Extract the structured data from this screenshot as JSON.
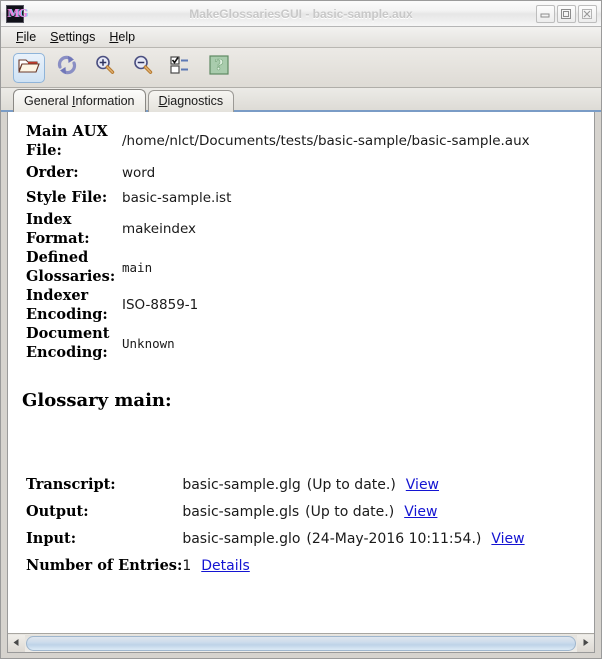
{
  "window": {
    "title": "MakeGlossariesGUI - basic-sample.aux",
    "app_icon": "MG",
    "controls": {
      "minimize": "minimize-icon",
      "maximize": "maximize-icon",
      "close": "close-icon"
    }
  },
  "menubar": {
    "items": [
      {
        "label": "File",
        "mnemonic": "F"
      },
      {
        "label": "Settings",
        "mnemonic": "S"
      },
      {
        "label": "Help",
        "mnemonic": "H"
      }
    ]
  },
  "toolbar": {
    "buttons": [
      {
        "icon": "open-folder-icon",
        "name": "open-button",
        "active": true
      },
      {
        "icon": "refresh-icon",
        "name": "reload-button",
        "active": false
      },
      {
        "icon": "zoom-in-icon",
        "name": "zoom-in-button",
        "active": false
      },
      {
        "icon": "zoom-out-icon",
        "name": "zoom-out-button",
        "active": false
      },
      {
        "icon": "checklist-icon",
        "name": "settings-button",
        "active": false
      },
      {
        "icon": "help-icon",
        "name": "help-button",
        "active": false
      }
    ]
  },
  "tabs": [
    {
      "label": "General Information",
      "mnemonic": "I",
      "selected": true
    },
    {
      "label": "Diagnostics",
      "mnemonic": "D",
      "selected": false
    }
  ],
  "general_info": {
    "rows": [
      {
        "label": "Main AUX File:",
        "value": "/home/nlct/Documents/tests/basic-sample/basic-sample.aux",
        "mono": false,
        "tall": true
      },
      {
        "label": "Order:",
        "value": "word",
        "mono": false,
        "tall": false
      },
      {
        "label": "Style File:",
        "value": "basic-sample.ist",
        "mono": false,
        "tall": false
      },
      {
        "label": "Index Format:",
        "value": "makeindex",
        "mono": false,
        "tall": true
      },
      {
        "label": "Defined Glossaries:",
        "value": "main",
        "mono": true,
        "tall": true
      },
      {
        "label": "Indexer Encoding:",
        "value": "ISO-8859-1",
        "mono": false,
        "tall": true
      },
      {
        "label": "Document Encoding:",
        "value": "Unknown",
        "mono": true,
        "tall": true
      }
    ]
  },
  "glossary": {
    "heading": "Glossary main:",
    "files": [
      {
        "label": "Transcript:",
        "filename": "basic-sample.glg",
        "status": "(Up to date.)",
        "link": "View"
      },
      {
        "label": "Output:",
        "filename": "basic-sample.gls",
        "status": "(Up to date.)",
        "link": "View"
      },
      {
        "label": "Input:",
        "filename": "basic-sample.glo",
        "status": "(24-May-2016 10:11:54.)",
        "link": "View"
      }
    ],
    "entries": {
      "label": "Number of Entries:",
      "count": "1",
      "link": "Details"
    }
  },
  "scrollbar": {
    "left_arrow": "arrow-left-icon",
    "right_arrow": "arrow-right-icon"
  },
  "colors": {
    "link": "#1414d2",
    "tab_underline": "#7a9cc6",
    "window_bg": "#d6d3ce",
    "content_bg": "#ffffff"
  }
}
